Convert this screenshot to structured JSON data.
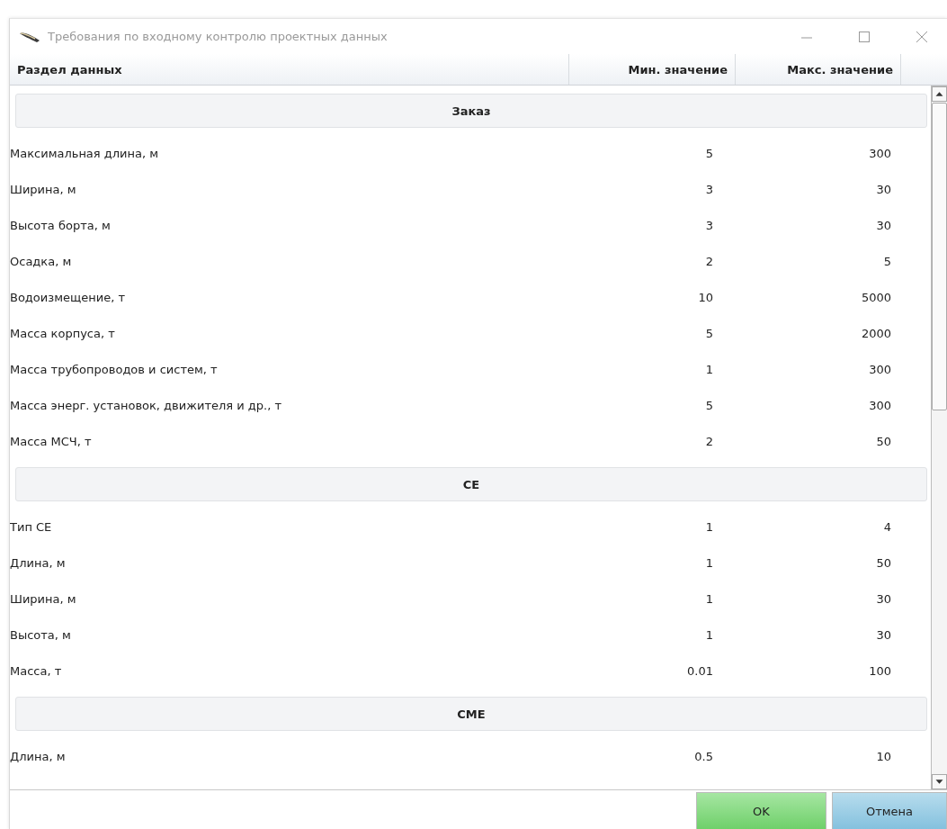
{
  "window": {
    "title": "Требования по входному контролю проектных данных"
  },
  "table": {
    "columns": [
      "Раздел данных",
      "Мин. значение",
      "Макс. значение"
    ],
    "groups": [
      {
        "title": "Заказ",
        "rows": [
          {
            "name": "Максимальная длина, м",
            "min": "5",
            "max": "300"
          },
          {
            "name": "Ширина, м",
            "min": "3",
            "max": "30"
          },
          {
            "name": "Высота борта, м",
            "min": "3",
            "max": "30"
          },
          {
            "name": "Осадка, м",
            "min": "2",
            "max": "5"
          },
          {
            "name": "Водоизмещение, т",
            "min": "10",
            "max": "5000"
          },
          {
            "name": "Масса корпуса, т",
            "min": "5",
            "max": "2000"
          },
          {
            "name": "Масса трубопроводов и систем, т",
            "min": "1",
            "max": "300"
          },
          {
            "name": "Масса энерг. установок, движителя и др., т",
            "min": "5",
            "max": "300"
          },
          {
            "name": "Масса МСЧ, т",
            "min": "2",
            "max": "50"
          }
        ]
      },
      {
        "title": "СЕ",
        "rows": [
          {
            "name": "Тип СЕ",
            "min": "1",
            "max": "4"
          },
          {
            "name": "Длина, м",
            "min": "1",
            "max": "50"
          },
          {
            "name": "Ширина, м",
            "min": "1",
            "max": "30"
          },
          {
            "name": "Высота, м",
            "min": "1",
            "max": "30"
          },
          {
            "name": "Масса, т",
            "min": "0.01",
            "max": "100"
          }
        ]
      },
      {
        "title": "СМЕ",
        "rows": [
          {
            "name": "Длина, м",
            "min": "0.5",
            "max": "10"
          }
        ]
      }
    ]
  },
  "buttons": [
    {
      "label": "OK",
      "kind": "primary"
    },
    {
      "label": "Отмена",
      "kind": "secondary"
    }
  ]
}
